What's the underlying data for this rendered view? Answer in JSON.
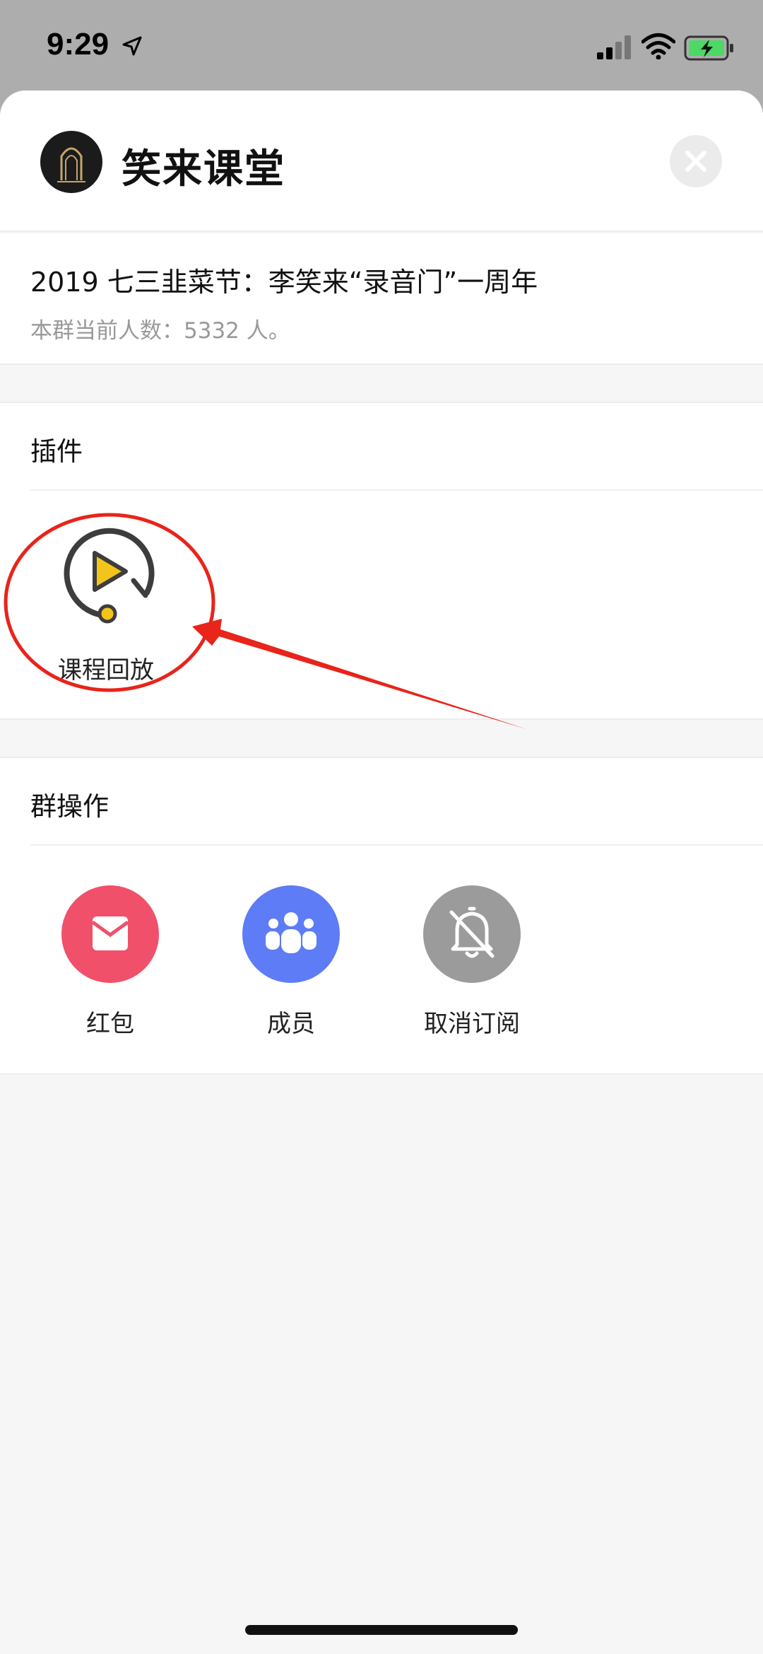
{
  "status": {
    "time": "9:29"
  },
  "header": {
    "title": "笑来课堂"
  },
  "group": {
    "title": "2019 七三韭菜节：李笑来“录音门”一周年",
    "member_count_text": "本群当前人数：5332 人。"
  },
  "plugins": {
    "title": "插件",
    "items": [
      {
        "label": "课程回放",
        "icon": "play-replay-icon"
      }
    ]
  },
  "ops": {
    "title": "群操作",
    "items": [
      {
        "label": "红包",
        "icon": "envelope-icon",
        "color": "#f0506a"
      },
      {
        "label": "成员",
        "icon": "group-icon",
        "color": "#5e7cf5"
      },
      {
        "label": "取消订阅",
        "icon": "bell-off-icon",
        "color": "#9b9b9b"
      }
    ]
  },
  "colors": {
    "annotation": "#e8241b",
    "play_yellow": "#f3c51a"
  }
}
